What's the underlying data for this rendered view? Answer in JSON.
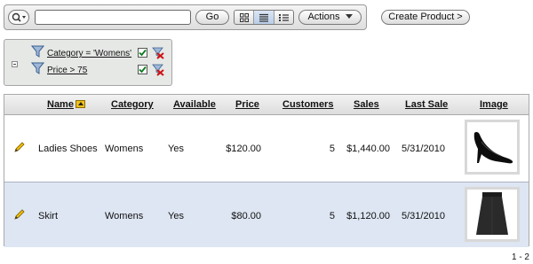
{
  "toolbar": {
    "search_value": "",
    "go_label": "Go",
    "actions_label": "Actions",
    "create_label": "Create Product >",
    "view_modes": [
      "icon-view",
      "report-view",
      "detail-view"
    ],
    "active_view": "report-view"
  },
  "filters": [
    {
      "label": "Category = 'Womens'",
      "enabled": true
    },
    {
      "label": "Price > 75",
      "enabled": true
    }
  ],
  "table": {
    "headers": {
      "name": "Name",
      "category": "Category",
      "available": "Available",
      "price": "Price",
      "customers": "Customers",
      "sales": "Sales",
      "last_sale": "Last Sale",
      "image": "Image"
    },
    "sorted_column": "name",
    "sort_direction": "ascending",
    "rows": [
      {
        "name": "Ladies Shoes",
        "category": "Womens",
        "available": "Yes",
        "price": "$120.00",
        "customers": "5",
        "sales": "$1,440.00",
        "last_sale": "5/31/2010",
        "image": "black-high-heel-shoe"
      },
      {
        "name": "Skirt",
        "category": "Womens",
        "available": "Yes",
        "price": "$80.00",
        "customers": "5",
        "sales": "$1,120.00",
        "last_sale": "5/31/2010",
        "image": "black-skirt"
      }
    ]
  },
  "pagination": "1 - 2",
  "colors": {
    "alt_row": "#dde6f2",
    "panel": "#e6e8e6",
    "sort_icon": "#f0c020"
  }
}
